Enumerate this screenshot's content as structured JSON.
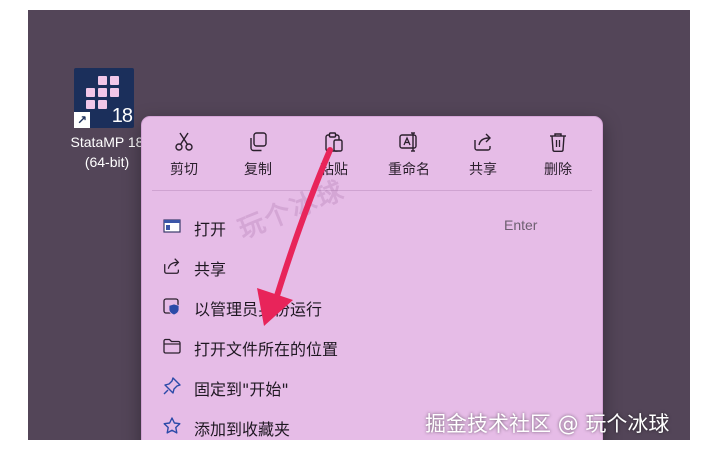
{
  "desktop": {
    "icon": {
      "name": "stata-icon",
      "version_badge": "18",
      "label_line1": "StataMP 18",
      "label_line2": "(64-bit)"
    }
  },
  "context_menu": {
    "toolbar": [
      {
        "label": "剪切",
        "icon": "scissors-icon"
      },
      {
        "label": "复制",
        "icon": "copy-icon"
      },
      {
        "label": "粘贴",
        "icon": "clipboard-icon"
      },
      {
        "label": "重命名",
        "icon": "rename-icon"
      },
      {
        "label": "共享",
        "icon": "share-icon"
      },
      {
        "label": "删除",
        "icon": "trash-icon"
      }
    ],
    "items": [
      {
        "label": "打开",
        "shortcut": "Enter",
        "icon": "app-window-icon"
      },
      {
        "label": "共享",
        "icon": "share-icon"
      },
      {
        "label": "以管理员身份运行",
        "icon": "shield-icon"
      },
      {
        "label": "打开文件所在的位置",
        "icon": "folder-icon"
      },
      {
        "label": "固定到\"开始\"",
        "icon": "pin-icon"
      },
      {
        "label": "添加到收藏夹",
        "icon": "star-icon"
      }
    ]
  },
  "watermarks": {
    "center": "玩个冰球",
    "bottom": "掘金技术社区 @ 玩个冰球"
  },
  "colors": {
    "desktop_bg": "#534558",
    "menu_bg": "#e6bce7",
    "accent_arrow": "#e8245a",
    "icon_bg": "#1b2f5b"
  }
}
